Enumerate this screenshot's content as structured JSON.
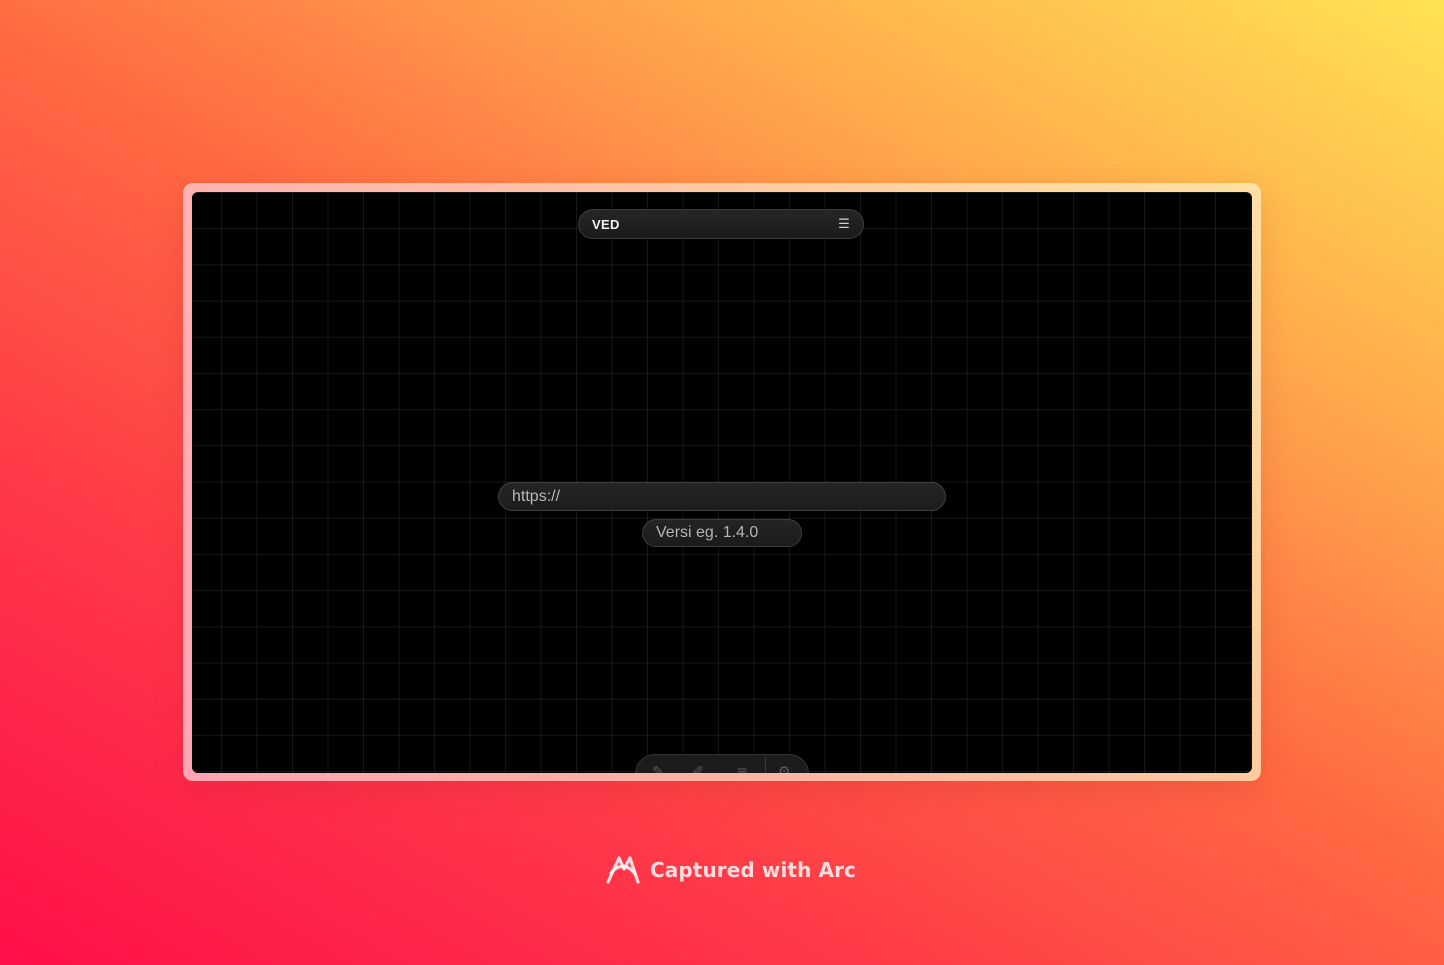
{
  "app": {
    "brand": "VED",
    "menu_icon": "hamburger-menu-icon"
  },
  "inputs": {
    "url_placeholder": "https://",
    "version_placeholder": "Versi eg. 1.4.0"
  },
  "toolbar": {
    "icons": [
      "pen-icon",
      "brush-icon",
      "lines-icon",
      "gear-icon"
    ]
  },
  "watermark": {
    "text": "Captured with Arc",
    "logo": "arc-logo-icon"
  },
  "colors": {
    "canvas": "#000000",
    "pill": "#1e1e1e",
    "pill_border": "#3e3e3e",
    "text": "#f2f2f2"
  }
}
